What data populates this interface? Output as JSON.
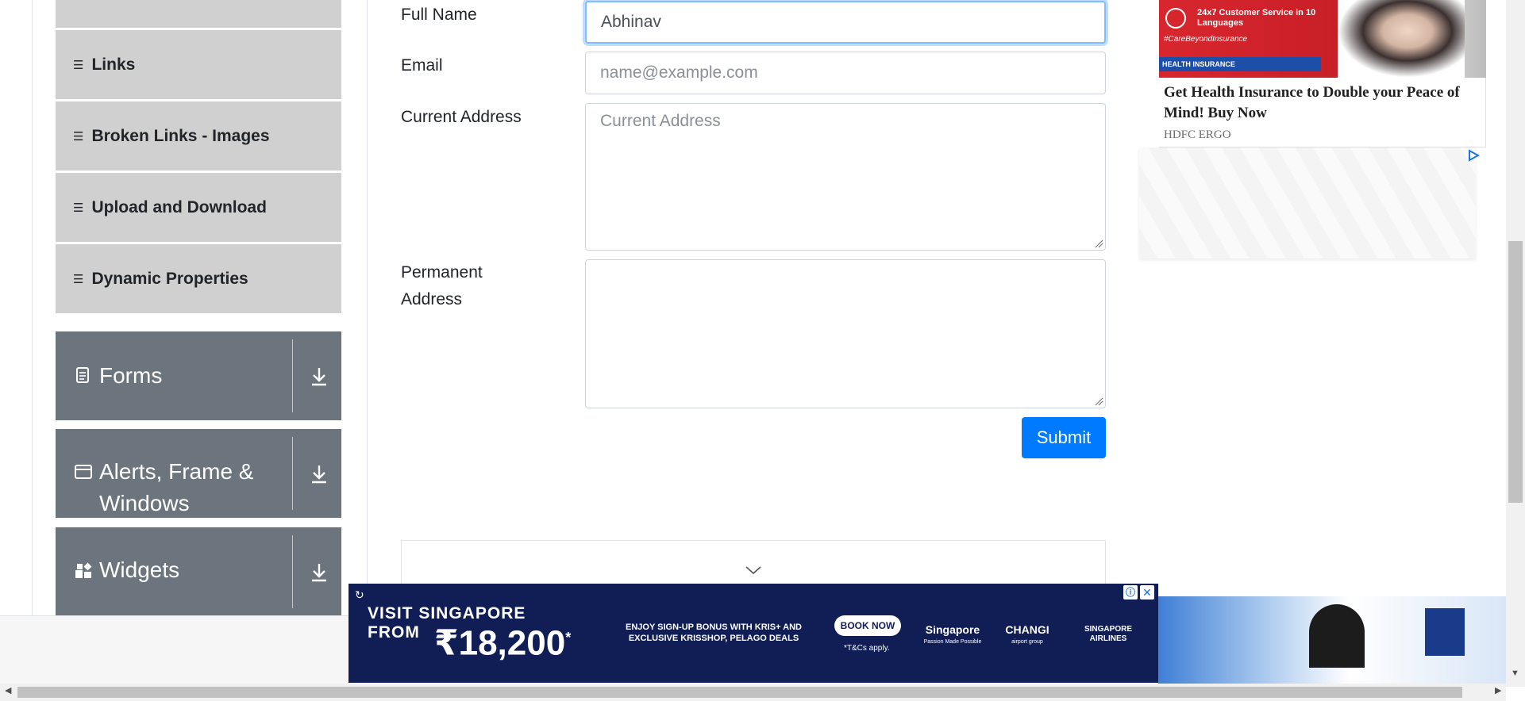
{
  "sidebar": {
    "elements_items": [
      {
        "label": "Links"
      },
      {
        "label": "Broken Links - Images"
      },
      {
        "label": "Upload and Download"
      },
      {
        "label": "Dynamic Properties"
      }
    ],
    "groups": [
      {
        "label": "Forms",
        "icon": "document-icon"
      },
      {
        "label": "Alerts, Frame & Windows",
        "icon": "window-icon"
      },
      {
        "label": "Widgets",
        "icon": "widgets-icon"
      }
    ]
  },
  "form": {
    "full_name_label": "Full Name",
    "full_name_value": "Abhinav",
    "email_label": "Email",
    "email_placeholder": "name@example.com",
    "current_address_label": "Current Address",
    "current_address_placeholder": "Current Address",
    "permanent_address_label": "Permanent Address",
    "submit_label": "Submit"
  },
  "right_ad": {
    "top_text": "24x7 Customer Service in 10 Languages",
    "hashtag": "#CareBeyondInsurance",
    "strip_text": "HEALTH INSURANCE",
    "headline": "Get Health Insurance to Double your Peace of Mind! Buy Now",
    "brand": "HDFC ERGO"
  },
  "banner_ad": {
    "line1": "VISIT SINGAPORE",
    "line2": "FROM",
    "price": "₹18,200",
    "price_suffix": "*",
    "offer": "ENJOY SIGN-UP BONUS WITH KRIS+ AND EXCLUSIVE KRISSHOP, PELAGO DEALS",
    "cta": "BOOK NOW",
    "terms": "*T&Cs apply.",
    "logos": [
      {
        "name": "Singapore",
        "sub": "Passion Made Possible"
      },
      {
        "name": "CHANGI",
        "sub": "airport group"
      },
      {
        "name": "SINGAPORE AIRLINES",
        "sub": ""
      }
    ],
    "info_icon": "ⓘ",
    "close_icon": "✕"
  },
  "colors": {
    "sidebar_item_bg": "#d0d0d0",
    "group_bg": "#6c757d",
    "submit_bg": "#007bff",
    "banner_bg": "#111e56"
  }
}
